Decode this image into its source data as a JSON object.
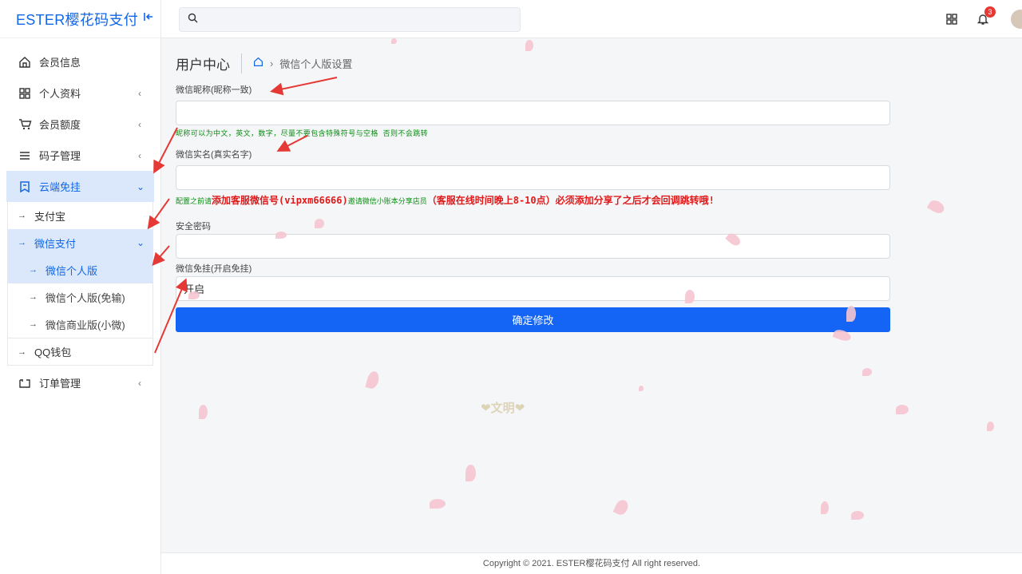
{
  "brand": {
    "title": "ESTER樱花码支付",
    "collapse_icon": "collapse-left-icon"
  },
  "sidebar": {
    "items": [
      {
        "label": "会员信息",
        "icon": "home-icon"
      },
      {
        "label": "个人资料",
        "icon": "grid-icon"
      },
      {
        "label": "会员额度",
        "icon": "cart-icon"
      },
      {
        "label": "码子管理",
        "icon": "menu-icon"
      },
      {
        "label": "云端免挂",
        "icon": "bookmark-icon"
      },
      {
        "label": "订单管理",
        "icon": "folder-icon"
      }
    ],
    "sub": {
      "alipay": "支付宝",
      "wechat": "微信支付",
      "wechat_children": [
        "微信个人版",
        "微信个人版(免输)",
        "微信商业版(小微)"
      ],
      "qq": "QQ钱包"
    }
  },
  "header": {
    "search_placeholder": "",
    "notification_count": "3"
  },
  "page": {
    "title": "用户中心",
    "breadcrumb": "微信个人版设置"
  },
  "form": {
    "nickname_label": "微信昵称(昵称一致)",
    "nickname_value": "",
    "nickname_hint": "昵称可以为中文，英文，数字，尽量不要包含特殊符号与空格 否则不会跳转",
    "realname_label": "微信实名(真实名字)",
    "realname_value": "",
    "realname_hint_pre": "配置之前请",
    "realname_hint_red1": "添加客服微信号(vipxm66666)",
    "realname_hint_mid": "邀请微信小账本分享店员",
    "realname_hint_red2": "（客服在线时间晚上8-10点）必须添加分享了之后才会回调跳转哦!",
    "password_label": "安全密码",
    "password_value": "",
    "autoreply_label": "微信免挂(开启免挂)",
    "autoreply_value": "开启",
    "submit_label": "确定修改"
  },
  "watermark": "❤文明❤",
  "footer": "Copyright © 2021. ESTER樱花码支付 All right reserved."
}
